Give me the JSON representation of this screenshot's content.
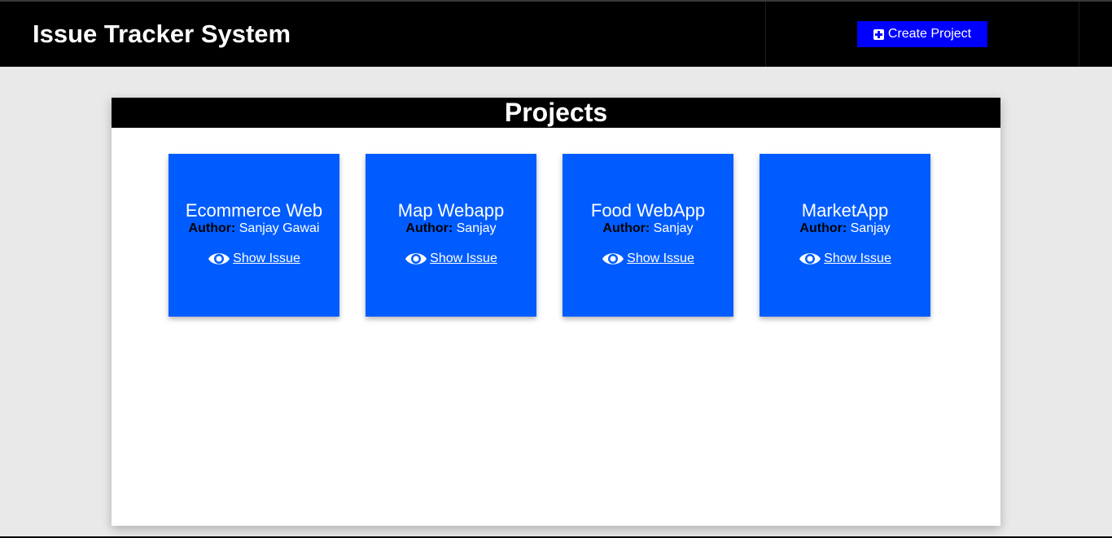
{
  "header": {
    "title": "Issue Tracker System",
    "create_button_label": "Create Project",
    "create_icon": "plus-square-icon"
  },
  "projects_panel": {
    "heading": "Projects",
    "author_label": "Author:",
    "show_issue_label": " Show Issue",
    "show_icon": "eye-icon",
    "items": [
      {
        "title": "Ecommerce Web",
        "author": " Sanjay Gawai"
      },
      {
        "title": "Map Webapp",
        "author": " Sanjay"
      },
      {
        "title": "Food WebApp",
        "author": " Sanjay"
      },
      {
        "title": "MarketApp",
        "author": " Sanjay"
      }
    ]
  },
  "colors": {
    "header_bg": "#000000",
    "button_bg": "#0000ff",
    "card_bg": "#005cff",
    "page_bg": "#e9e9e9"
  }
}
